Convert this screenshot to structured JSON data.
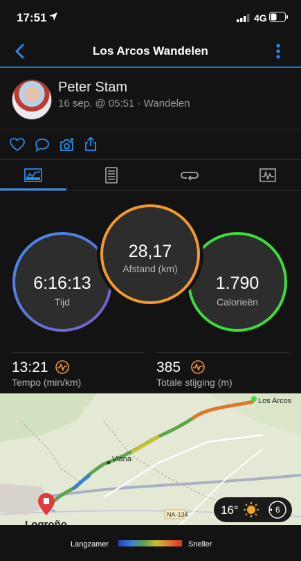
{
  "status": {
    "time": "17:51",
    "network": "4G"
  },
  "header": {
    "title": "Los Arcos Wandelen"
  },
  "user": {
    "name": "Peter Stam",
    "meta": "16 sep. @ 05:51 · Wandelen"
  },
  "metrics": {
    "distance": {
      "value": "28,17",
      "label": "Afstand (km)",
      "color": "#f39a2b"
    },
    "time": {
      "value": "6:16:13",
      "label": "Tijd",
      "color_start": "#3f8ef0",
      "color_end": "#7b5cc9"
    },
    "calories": {
      "value": "1.790",
      "label": "Calorieën",
      "color": "#3ddc3d"
    }
  },
  "stats": {
    "pace": {
      "value": "13:21",
      "label": "Tempo (min/km)"
    },
    "ascent": {
      "value": "385",
      "label": "Totale stijging (m)"
    }
  },
  "map": {
    "labels": {
      "start": "Los Arcos",
      "mid": "Viana",
      "end": "Logroño",
      "road": "NA-134"
    },
    "weather": {
      "temp": "16°",
      "wind": "6"
    }
  },
  "legend": {
    "slower": "Langzamer",
    "faster": "Sneller"
  },
  "colors": {
    "accent": "#2a8be8",
    "background": "#131313"
  }
}
